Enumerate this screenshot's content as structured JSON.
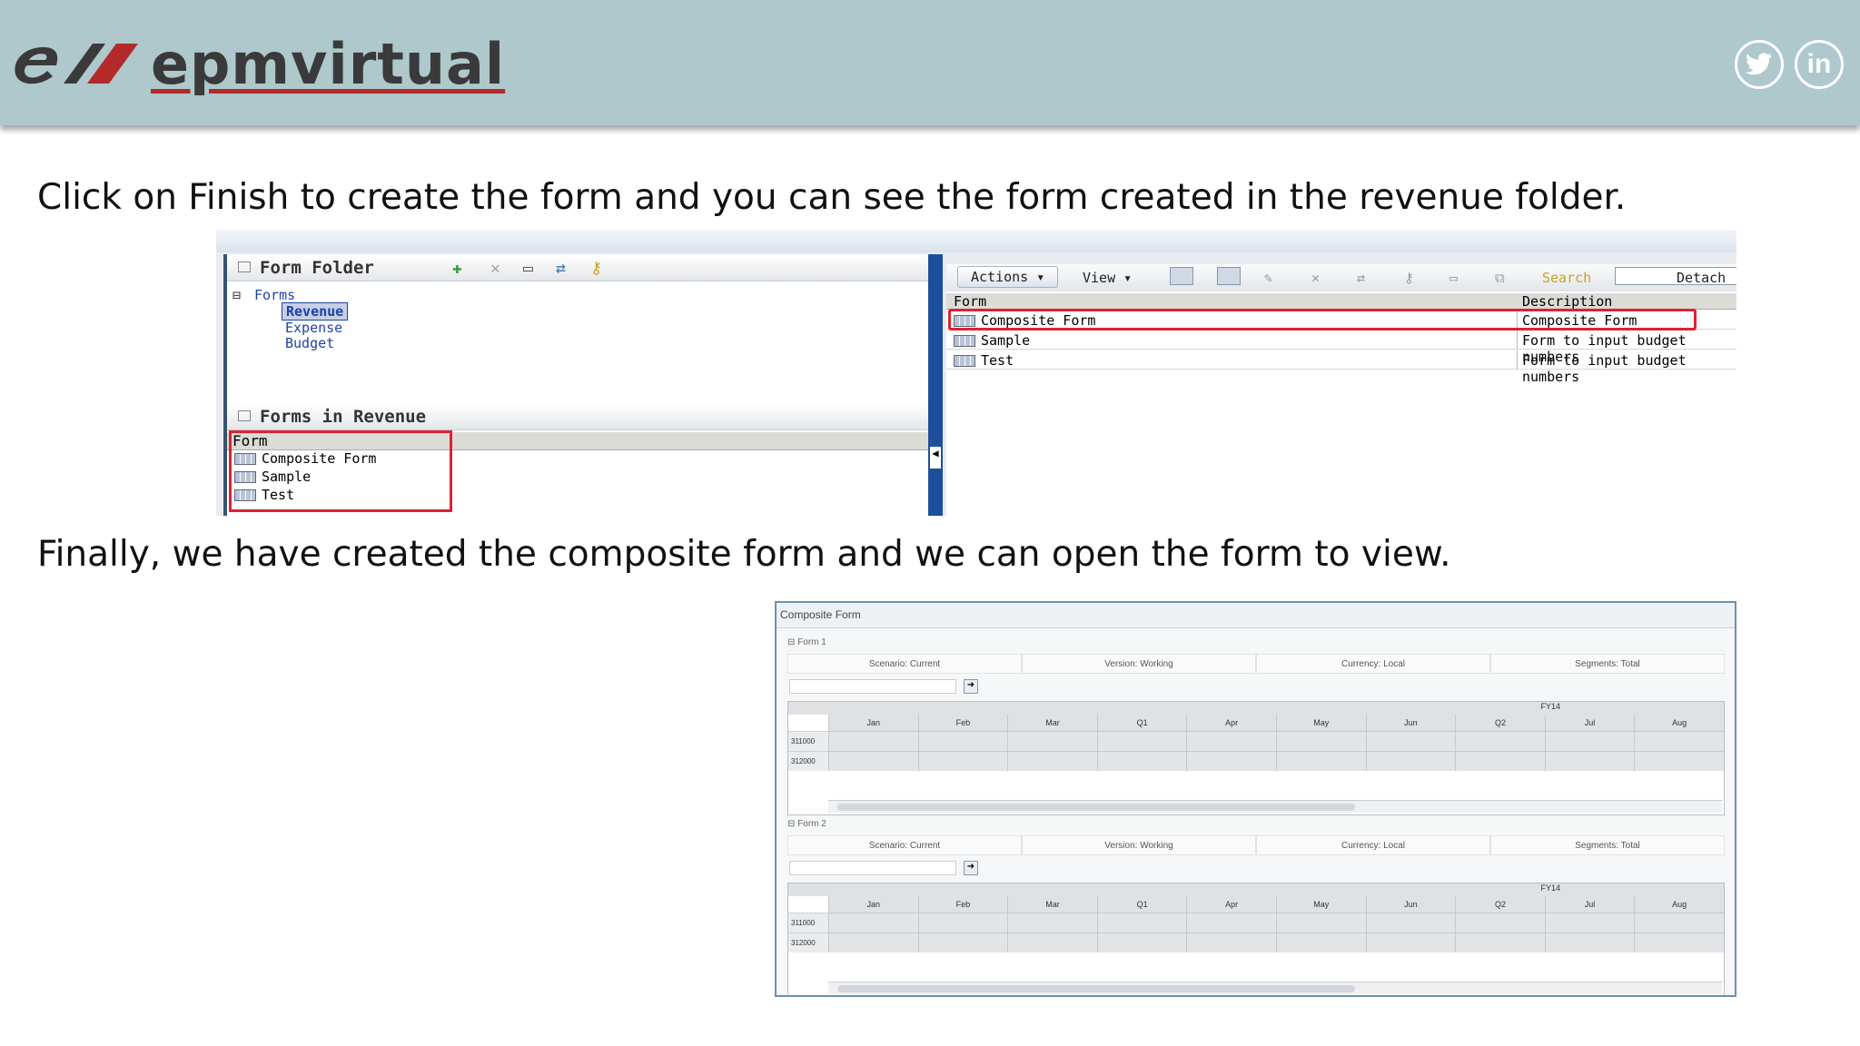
{
  "header": {
    "logo_text": "epmvirtual",
    "social": [
      "twitter-icon",
      "linkedin-icon"
    ],
    "colors": {
      "bar": "#aec8cc",
      "logo_red": "#b22a2a",
      "logo_gray": "#3a3a3a"
    }
  },
  "captions": {
    "first": "Click on Finish to create the form and you can see the form created in the revenue folder.",
    "second": "Finally, we have created the composite form and we can open the form to view."
  },
  "screenshot1": {
    "left_panel": {
      "folder_header": "Form Folder",
      "tree_root": "Forms",
      "tree_items": [
        "Revenue",
        "Expense",
        "Budget"
      ],
      "selected": "Revenue",
      "forms_header": "Forms in Revenue",
      "column": "Form",
      "forms": [
        "Composite Form",
        "Sample",
        "Test"
      ]
    },
    "right_panel": {
      "actions_label": "Actions",
      "view_label": "View",
      "search_label": "Search",
      "detach_label": "Detach",
      "columns": [
        "Form",
        "Description"
      ],
      "rows": [
        {
          "form": "Composite Form",
          "description": "Composite Form"
        },
        {
          "form": "Sample",
          "description": "Form to input budget numbers"
        },
        {
          "form": "Test",
          "description": "Form to input budget numbers"
        }
      ]
    },
    "highlight_color": "#dd2233"
  },
  "screenshot2": {
    "title": "Composite Form",
    "sections": [
      {
        "label": "Form 1",
        "pov": [
          "Scenario: Current",
          "Version: Working",
          "Currency: Local",
          "Segments: Total"
        ],
        "year": "FY14",
        "months": [
          "Jan",
          "Feb",
          "Mar",
          "Q1",
          "Apr",
          "May",
          "Jun",
          "Q2",
          "Jul",
          "Aug"
        ],
        "rows": [
          "311000",
          "312000"
        ]
      },
      {
        "label": "Form 2",
        "pov": [
          "Scenario: Current",
          "Version: Working",
          "Currency: Local",
          "Segments: Total"
        ],
        "year": "FY14",
        "months": [
          "Jan",
          "Feb",
          "Mar",
          "Q1",
          "Apr",
          "May",
          "Jun",
          "Q2",
          "Jul",
          "Aug"
        ],
        "rows": [
          "311000",
          "312000"
        ]
      }
    ]
  }
}
